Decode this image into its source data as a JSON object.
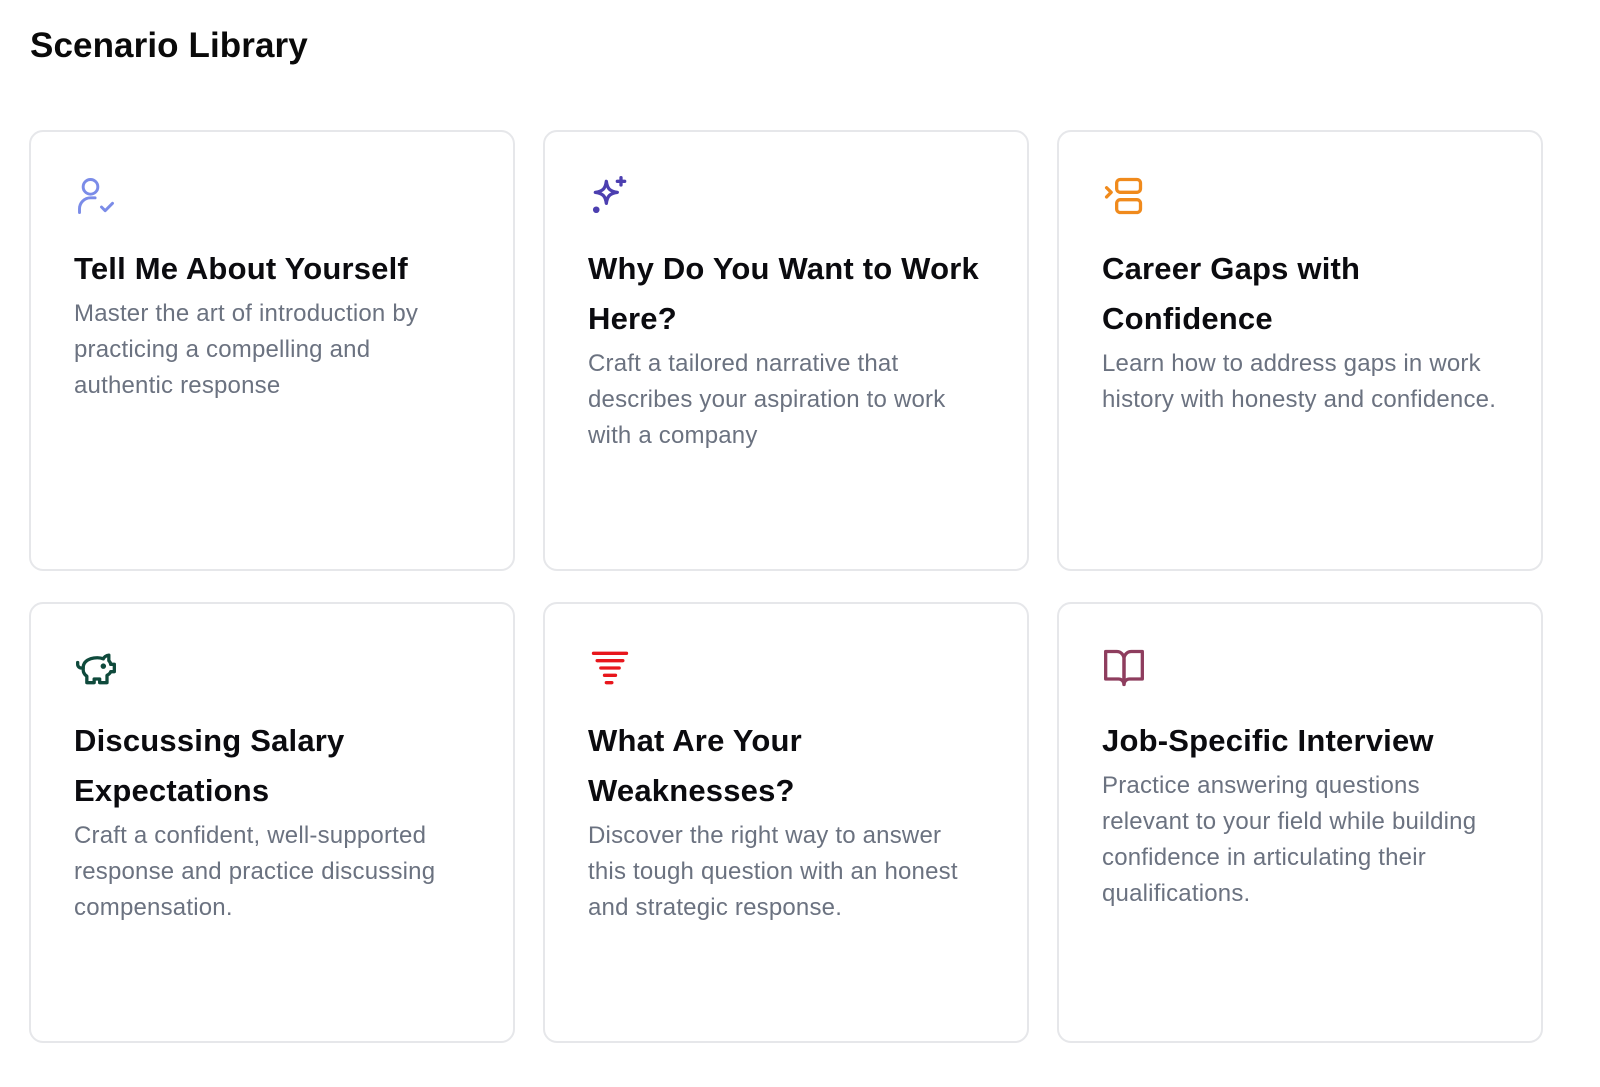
{
  "page": {
    "title": "Scenario Library"
  },
  "cards": [
    {
      "icon": "user-check-icon",
      "icon_color": "#7b8ce8",
      "title": "Tell Me About Yourself",
      "description": "Master the art of introduction by practicing a compelling and authentic response"
    },
    {
      "icon": "sparkles-icon",
      "icon_color": "#4c3fb0",
      "title": "Why Do You Want to Work Here?",
      "description": "Craft a tailored narrative that describes your aspiration to work with a company"
    },
    {
      "icon": "list-indent-icon",
      "icon_color": "#f08a1c",
      "title": "Career Gaps with Confidence",
      "description": "Learn how to address gaps in work history with honesty and confidence."
    },
    {
      "icon": "piggy-bank-icon",
      "icon_color": "#0f4a3c",
      "title": "Discussing Salary Expectations",
      "description": "Craft a confident, well-supported response and practice discussing compensation."
    },
    {
      "icon": "tornado-icon",
      "icon_color": "#e8161c",
      "title": "What Are Your Weaknesses?",
      "description": "Discover the right way to answer this tough question with an honest and strategic response."
    },
    {
      "icon": "book-open-icon",
      "icon_color": "#8e3d5e",
      "title": "Job-Specific Interview",
      "description": "Practice answering questions relevant to your field while building confidence in articulating their qualifications."
    }
  ]
}
